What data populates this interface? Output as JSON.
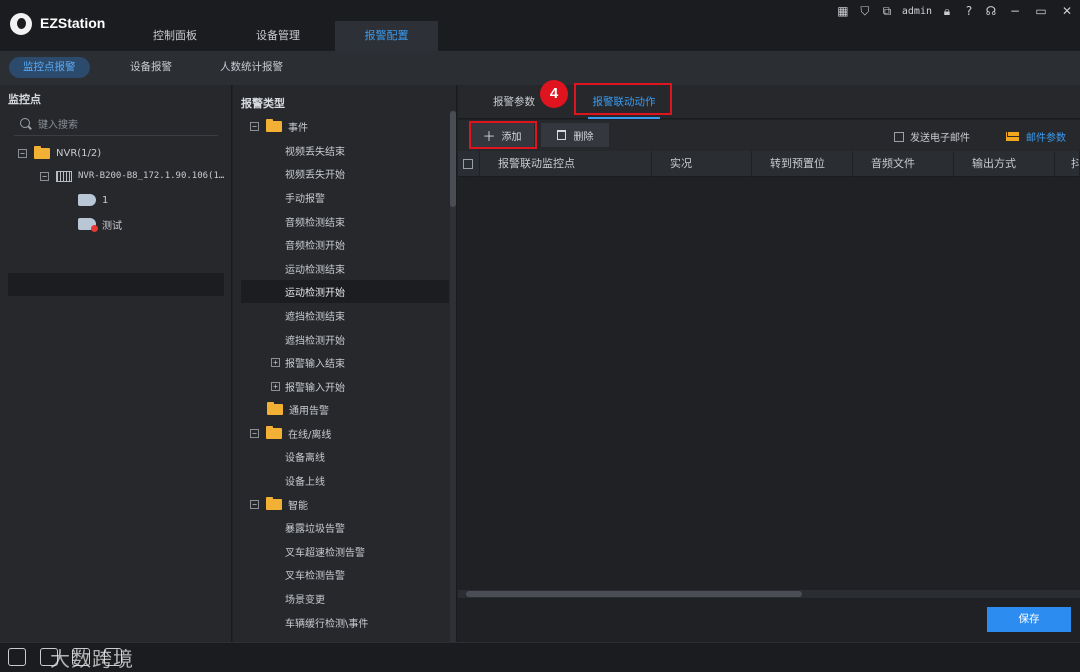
{
  "app": {
    "title": "EZStation"
  },
  "main_tabs": [
    {
      "label": "控制面板"
    },
    {
      "label": "设备管理"
    },
    {
      "label": "报警配置"
    }
  ],
  "window_controls": {
    "user": "admin",
    "icons": [
      "grid-icon",
      "shirt-icon",
      "layout-icon",
      "lock-icon",
      "help-icon",
      "headset-icon",
      "minimize-icon",
      "maximize-icon",
      "close-icon"
    ]
  },
  "sub_tabs": [
    {
      "label": "监控点报警"
    },
    {
      "label": "设备报警"
    },
    {
      "label": "人数统计报警"
    }
  ],
  "left_panel": {
    "title": "监控点",
    "search_placeholder": "键入搜索",
    "tree": [
      {
        "label": "NVR(1/2)",
        "toggle": "−"
      },
      {
        "label": "NVR-B200-B8_172.1.90.106(1…",
        "toggle": "−"
      },
      {
        "label": "1"
      },
      {
        "label": "测试"
      }
    ]
  },
  "middle_panel": {
    "title": "报警类型",
    "items": [
      {
        "label": "事件",
        "toggle": "−"
      },
      {
        "label": "视频丢失结束"
      },
      {
        "label": "视频丢失开始"
      },
      {
        "label": "手动报警"
      },
      {
        "label": "音频检测结束"
      },
      {
        "label": "音频检测开始"
      },
      {
        "label": "运动检测结束"
      },
      {
        "label": "运动检测开始"
      },
      {
        "label": "遮挡检测结束"
      },
      {
        "label": "遮挡检测开始"
      },
      {
        "label": "报警输入结束",
        "toggle": "+"
      },
      {
        "label": "报警输入开始",
        "toggle": "+"
      },
      {
        "label": "通用告警"
      },
      {
        "label": "在线/离线",
        "toggle": "−"
      },
      {
        "label": "设备离线"
      },
      {
        "label": "设备上线"
      },
      {
        "label": "智能",
        "toggle": "−"
      },
      {
        "label": "暴露垃圾告警"
      },
      {
        "label": "叉车超速检测告警"
      },
      {
        "label": "叉车检测告警"
      },
      {
        "label": "场景变更"
      },
      {
        "label": "车辆缓行检测\\事件"
      }
    ]
  },
  "right_panel": {
    "tabs": [
      {
        "label": "报警参数"
      },
      {
        "label": "报警联动动作"
      }
    ],
    "step_badge": "4",
    "toolbar": {
      "add_label": "添加",
      "delete_label": "删除",
      "send_email_label": "发送电子邮件",
      "mail_params_label": "邮件参数"
    },
    "table_headers": [
      "报警联动监控点",
      "实况",
      "转到预置位",
      "音频文件",
      "输出方式",
      "抖"
    ],
    "save_label": "保存"
  },
  "watermark": "大数跨境",
  "colors": {
    "accent": "#3a9bf0",
    "highlight": "#e0141e",
    "folder": "#f2b134",
    "save": "#2d8cf0"
  }
}
